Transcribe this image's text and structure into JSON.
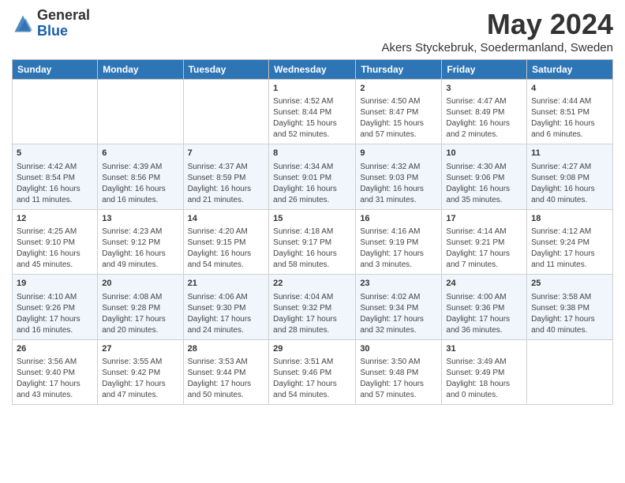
{
  "header": {
    "logo_line1": "General",
    "logo_line2": "Blue",
    "main_title": "May 2024",
    "subtitle": "Akers Styckebruk, Soedermanland, Sweden"
  },
  "days_of_week": [
    "Sunday",
    "Monday",
    "Tuesday",
    "Wednesday",
    "Thursday",
    "Friday",
    "Saturday"
  ],
  "weeks": [
    [
      {
        "day": "",
        "info": ""
      },
      {
        "day": "",
        "info": ""
      },
      {
        "day": "",
        "info": ""
      },
      {
        "day": "1",
        "info": "Sunrise: 4:52 AM\nSunset: 8:44 PM\nDaylight: 15 hours and 52 minutes."
      },
      {
        "day": "2",
        "info": "Sunrise: 4:50 AM\nSunset: 8:47 PM\nDaylight: 15 hours and 57 minutes."
      },
      {
        "day": "3",
        "info": "Sunrise: 4:47 AM\nSunset: 8:49 PM\nDaylight: 16 hours and 2 minutes."
      },
      {
        "day": "4",
        "info": "Sunrise: 4:44 AM\nSunset: 8:51 PM\nDaylight: 16 hours and 6 minutes."
      }
    ],
    [
      {
        "day": "5",
        "info": "Sunrise: 4:42 AM\nSunset: 8:54 PM\nDaylight: 16 hours and 11 minutes."
      },
      {
        "day": "6",
        "info": "Sunrise: 4:39 AM\nSunset: 8:56 PM\nDaylight: 16 hours and 16 minutes."
      },
      {
        "day": "7",
        "info": "Sunrise: 4:37 AM\nSunset: 8:59 PM\nDaylight: 16 hours and 21 minutes."
      },
      {
        "day": "8",
        "info": "Sunrise: 4:34 AM\nSunset: 9:01 PM\nDaylight: 16 hours and 26 minutes."
      },
      {
        "day": "9",
        "info": "Sunrise: 4:32 AM\nSunset: 9:03 PM\nDaylight: 16 hours and 31 minutes."
      },
      {
        "day": "10",
        "info": "Sunrise: 4:30 AM\nSunset: 9:06 PM\nDaylight: 16 hours and 35 minutes."
      },
      {
        "day": "11",
        "info": "Sunrise: 4:27 AM\nSunset: 9:08 PM\nDaylight: 16 hours and 40 minutes."
      }
    ],
    [
      {
        "day": "12",
        "info": "Sunrise: 4:25 AM\nSunset: 9:10 PM\nDaylight: 16 hours and 45 minutes."
      },
      {
        "day": "13",
        "info": "Sunrise: 4:23 AM\nSunset: 9:12 PM\nDaylight: 16 hours and 49 minutes."
      },
      {
        "day": "14",
        "info": "Sunrise: 4:20 AM\nSunset: 9:15 PM\nDaylight: 16 hours and 54 minutes."
      },
      {
        "day": "15",
        "info": "Sunrise: 4:18 AM\nSunset: 9:17 PM\nDaylight: 16 hours and 58 minutes."
      },
      {
        "day": "16",
        "info": "Sunrise: 4:16 AM\nSunset: 9:19 PM\nDaylight: 17 hours and 3 minutes."
      },
      {
        "day": "17",
        "info": "Sunrise: 4:14 AM\nSunset: 9:21 PM\nDaylight: 17 hours and 7 minutes."
      },
      {
        "day": "18",
        "info": "Sunrise: 4:12 AM\nSunset: 9:24 PM\nDaylight: 17 hours and 11 minutes."
      }
    ],
    [
      {
        "day": "19",
        "info": "Sunrise: 4:10 AM\nSunset: 9:26 PM\nDaylight: 17 hours and 16 minutes."
      },
      {
        "day": "20",
        "info": "Sunrise: 4:08 AM\nSunset: 9:28 PM\nDaylight: 17 hours and 20 minutes."
      },
      {
        "day": "21",
        "info": "Sunrise: 4:06 AM\nSunset: 9:30 PM\nDaylight: 17 hours and 24 minutes."
      },
      {
        "day": "22",
        "info": "Sunrise: 4:04 AM\nSunset: 9:32 PM\nDaylight: 17 hours and 28 minutes."
      },
      {
        "day": "23",
        "info": "Sunrise: 4:02 AM\nSunset: 9:34 PM\nDaylight: 17 hours and 32 minutes."
      },
      {
        "day": "24",
        "info": "Sunrise: 4:00 AM\nSunset: 9:36 PM\nDaylight: 17 hours and 36 minutes."
      },
      {
        "day": "25",
        "info": "Sunrise: 3:58 AM\nSunset: 9:38 PM\nDaylight: 17 hours and 40 minutes."
      }
    ],
    [
      {
        "day": "26",
        "info": "Sunrise: 3:56 AM\nSunset: 9:40 PM\nDaylight: 17 hours and 43 minutes."
      },
      {
        "day": "27",
        "info": "Sunrise: 3:55 AM\nSunset: 9:42 PM\nDaylight: 17 hours and 47 minutes."
      },
      {
        "day": "28",
        "info": "Sunrise: 3:53 AM\nSunset: 9:44 PM\nDaylight: 17 hours and 50 minutes."
      },
      {
        "day": "29",
        "info": "Sunrise: 3:51 AM\nSunset: 9:46 PM\nDaylight: 17 hours and 54 minutes."
      },
      {
        "day": "30",
        "info": "Sunrise: 3:50 AM\nSunset: 9:48 PM\nDaylight: 17 hours and 57 minutes."
      },
      {
        "day": "31",
        "info": "Sunrise: 3:49 AM\nSunset: 9:49 PM\nDaylight: 18 hours and 0 minutes."
      },
      {
        "day": "",
        "info": ""
      }
    ]
  ]
}
